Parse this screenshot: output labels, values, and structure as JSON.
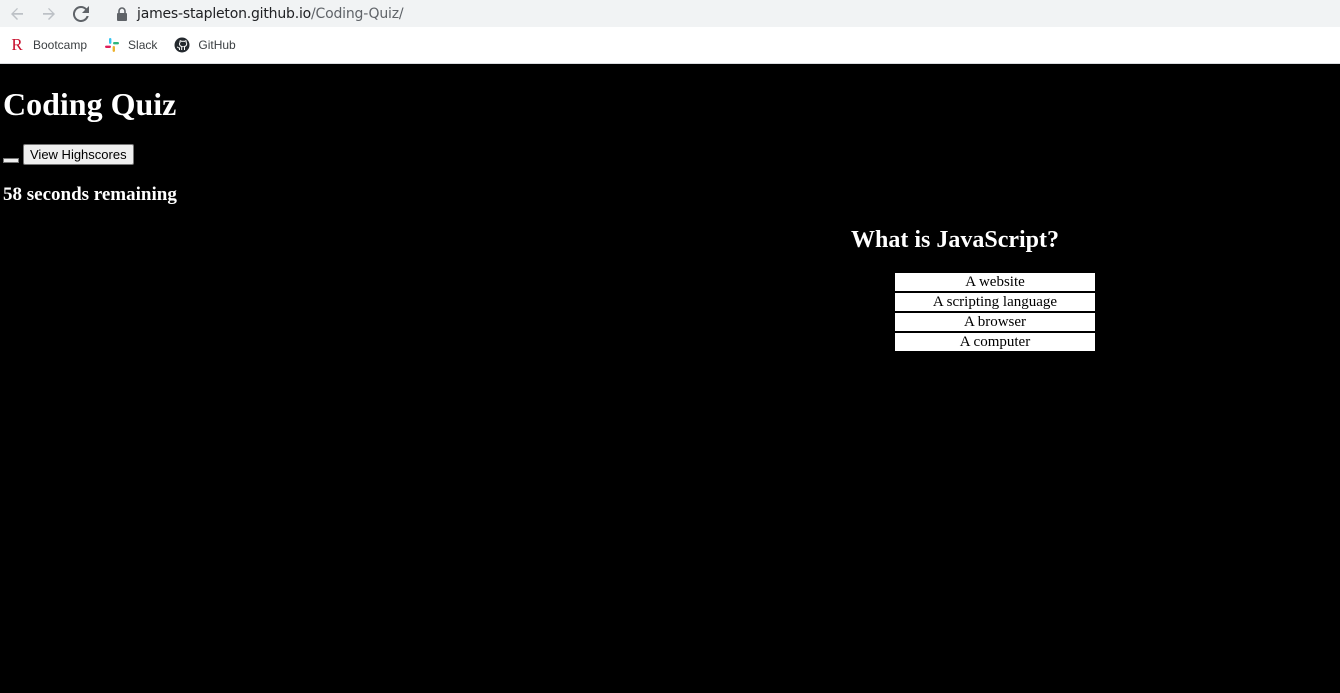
{
  "browser": {
    "url_domain": "james-stapleton.github.io",
    "url_path": "/Coding-Quiz/",
    "bookmarks": [
      {
        "label": "Bootcamp",
        "icon": "bootcamp-r-icon"
      },
      {
        "label": "Slack",
        "icon": "slack-icon"
      },
      {
        "label": "GitHub",
        "icon": "github-icon"
      }
    ]
  },
  "page": {
    "title": "Coding Quiz",
    "highscores_label": "View Highscores",
    "timer_text": "58 seconds remaining"
  },
  "quiz": {
    "question": "What is JavaScript?",
    "answers": [
      "A website",
      "A scripting language",
      "A browser",
      "A computer"
    ]
  },
  "colors": {
    "page_background": "#000000",
    "text": "#ffffff",
    "answer_background": "#ffffff"
  }
}
